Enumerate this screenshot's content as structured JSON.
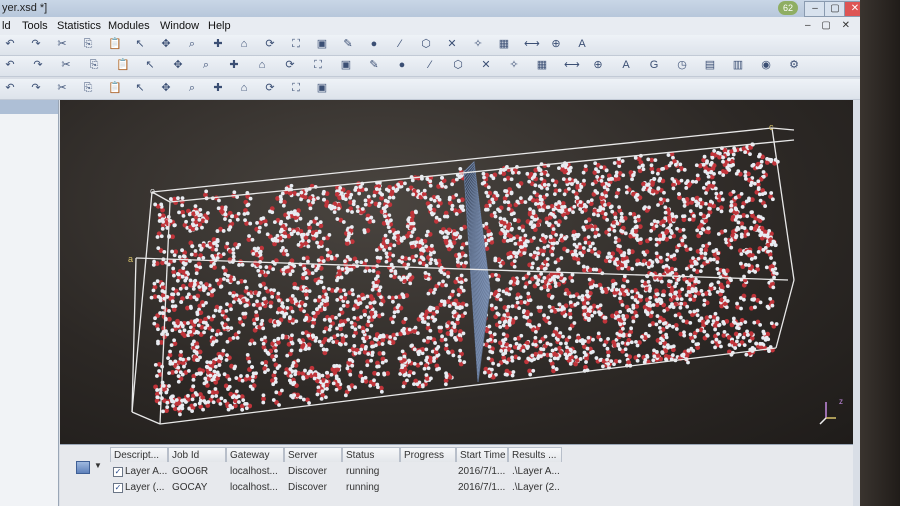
{
  "window": {
    "title": "yer.xsd *]",
    "badge": "62",
    "controls": [
      "–",
      "▢",
      "✕"
    ]
  },
  "menu": {
    "items": [
      "ld",
      "Tools",
      "Statistics",
      "Modules",
      "Window",
      "Help"
    ],
    "mdi_controls": "– ▢ ✕"
  },
  "toolbars": {
    "row1_icons": [
      "undo-icon",
      "redo-icon",
      "cut-icon",
      "copy-icon",
      "paste-icon",
      "pointer-icon",
      "move-icon",
      "zoom-icon",
      "pan-icon",
      "home-icon",
      "rotate-icon",
      "fit-icon",
      "screenshot-icon",
      "pencil-icon",
      "atom-icon",
      "bond-icon",
      "ring-icon",
      "delete-icon",
      "clean-icon",
      "grid-icon",
      "measure-icon",
      "symmetry-icon",
      "label-icon"
    ],
    "row2_icons": [
      "display-icon",
      "align-icon",
      "sort-icon",
      "sketch-icon",
      "lock-icon",
      "image-icon",
      "fx-icon",
      "select-icon",
      "zoom-icon",
      "translate-icon",
      "rotate-icon",
      "center-icon",
      "rebuild-icon",
      "crystal-icon",
      "surface-icon",
      "cell-icon",
      "layer-icon",
      "molecule-icon",
      "vector-icon",
      "color-icon",
      "pattern-icon",
      "G-icon",
      "clock-icon",
      "table-icon",
      "chart-icon",
      "sphere-icon",
      "graph-icon",
      "scissor-icon",
      "gear-icon"
    ],
    "row3_icons": [
      "sphere-blue-icon",
      "molecule-icon",
      "molecule-red-icon",
      "script-icon",
      "play-icon",
      "loop-icon",
      "first-icon",
      "prev-icon",
      "stop-icon",
      "next-icon",
      "last-icon",
      "record-icon",
      "cycle-icon"
    ]
  },
  "viewer": {
    "axis_labels": {
      "a": "a",
      "c": "c",
      "z": "z"
    }
  },
  "jobs": {
    "columns": [
      "Descript...",
      "Job Id",
      "Gateway",
      "Server",
      "Status",
      "Progress",
      "Start Time",
      "Results ..."
    ],
    "rows": [
      {
        "description": "Layer A...",
        "job_id": "GOO6R",
        "gateway": "localhost...",
        "server": "Discover",
        "status": "running",
        "progress": "",
        "start_time": "2016/7/1...",
        "results": ".\\Layer A..."
      },
      {
        "description": "Layer (...",
        "job_id": "GOCAY",
        "gateway": "localhost...",
        "server": "Discover",
        "status": "running",
        "progress": "",
        "start_time": "2016/7/1...",
        "results": ".\\Layer (2..."
      }
    ]
  },
  "colors": {
    "oxygen": "#c0343a",
    "hydrogen": "#e8ecf2",
    "graphene": "#5c6f8e",
    "cell_box": "#e8e8e8"
  }
}
